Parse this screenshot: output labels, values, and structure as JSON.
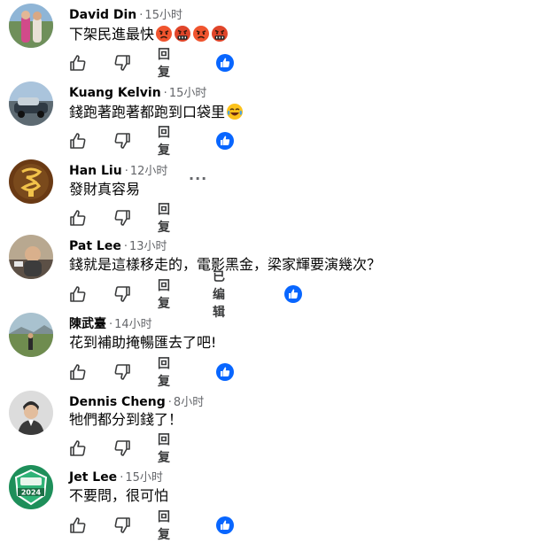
{
  "comments": [
    {
      "author": "David Din",
      "time": "15小时",
      "text": "下架民進最快",
      "emoji": [
        "angry-face-emoji",
        "cursing-face-emoji",
        "angry-face-emoji",
        "cursing-face-emoji"
      ],
      "reply_label": "回复",
      "edited_label": "",
      "has_reaction": true
    },
    {
      "author": "Kuang Kelvin",
      "time": "15小时",
      "text": "錢跑著跑著都跑到口袋里",
      "emoji": [
        "tears-of-joy-emoji"
      ],
      "reply_label": "回复",
      "edited_label": "",
      "has_reaction": true
    },
    {
      "author": "Han Liu",
      "time": "12小时",
      "text": "發財真容易",
      "emoji": [],
      "reply_label": "回复",
      "edited_label": "",
      "has_reaction": false,
      "more_label": "···"
    },
    {
      "author": "Pat Lee",
      "time": "13小时",
      "text": "錢就是這樣移走的，電影黑金，梁家輝要演幾次？",
      "emoji": [],
      "reply_label": "回复",
      "edited_label": "已编辑",
      "has_reaction": true
    },
    {
      "author": "陳武臺",
      "time": "14小时",
      "text": "花到補助掩暢匯去了吧!",
      "emoji": [],
      "reply_label": "回复",
      "edited_label": "",
      "has_reaction": true
    },
    {
      "author": "Dennis Cheng",
      "time": "8小时",
      "text": "牠們都分到錢了！",
      "emoji": [],
      "reply_label": "回复",
      "edited_label": "",
      "has_reaction": false
    },
    {
      "author": "Jet Lee",
      "time": "15小时",
      "text": "不要問，很可怕",
      "emoji": [],
      "reply_label": "回复",
      "edited_label": "",
      "has_reaction": true,
      "avatar_text": "2024"
    }
  ],
  "colors": {
    "link_blue": "#0866ff",
    "meta_gray": "#65676b",
    "action_gray": "#3a3b3c"
  }
}
